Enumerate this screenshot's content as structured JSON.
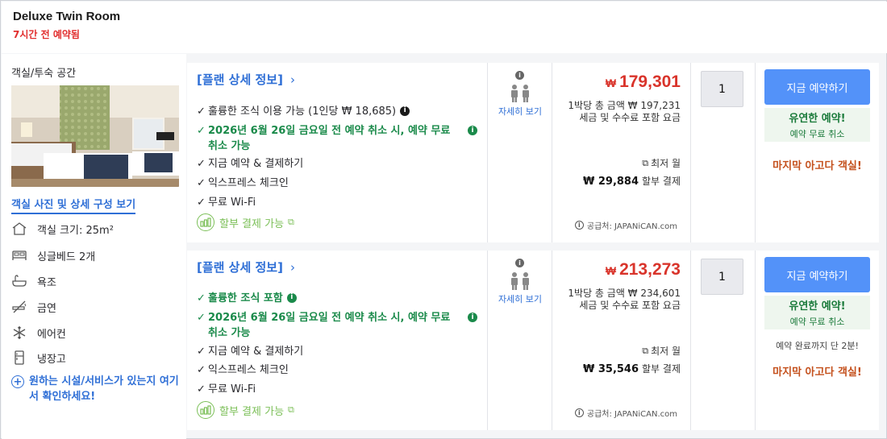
{
  "header": {
    "title": "Deluxe Twin Room",
    "booked_text": "7시간 전 예약됨"
  },
  "room": {
    "section_title": "객실/투숙 공간",
    "photo_link": "객실 사진 및 상세 구성 보기",
    "amenities": [
      {
        "icon": "house-icon",
        "label": "객실 크기: 25m²"
      },
      {
        "icon": "bed-icon",
        "label": "싱글베드 2개"
      },
      {
        "icon": "bathtub-icon",
        "label": "욕조"
      },
      {
        "icon": "no-smoking-icon",
        "label": "금연"
      },
      {
        "icon": "snowflake-icon",
        "label": "에어컨"
      },
      {
        "icon": "fridge-icon",
        "label": "냉장고"
      }
    ],
    "facility_link": "원하는 시설/서비스가 있는지 여기서 확인하세요!"
  },
  "plans": [
    {
      "plan_link": "[플랜 상세 정보]",
      "features": [
        {
          "text": "훌륭한 조식 이용 가능 (1인당 ₩ 18,685)",
          "green": false,
          "info": true
        },
        {
          "text": "2026년 6월 26일 금요일 전 예약 취소 시, 예약 무료 취소 가능",
          "green": true,
          "info": true
        },
        {
          "text": "지금 예약 & 결제하기",
          "green": false,
          "info": false
        },
        {
          "text": "익스프레스 체크인",
          "green": false,
          "info": false
        },
        {
          "text": "무료 Wi-Fi",
          "green": false,
          "info": false
        }
      ],
      "installment": "할부 결제 가능",
      "guests_link": "자세히 보기",
      "currency": "₩",
      "price": "179,301",
      "total_line": "1박당 총 금액 ₩ 197,231",
      "tax_line": "세금 및 수수료 포함 요금",
      "min_month": "최저 월",
      "install_amount": "₩ 29,884",
      "install_label": "할부 결제",
      "supplier": "공급처: JAPANiCAN.com",
      "qty": "1",
      "book_label": "지금 예약하기",
      "flex_title": "유연한 예약!",
      "flex_sub": "예약 무료 취소",
      "countdown": "",
      "last_room": "마지막 아고다 객실!"
    },
    {
      "plan_link": "[플랜 상세 정보]",
      "features": [
        {
          "text": "훌륭한 조식 포함",
          "green": true,
          "info": true,
          "inline": true
        },
        {
          "text": "2026년 6월 26일 금요일 전 예약 취소 시, 예약 무료 취소 가능",
          "green": true,
          "info": true
        },
        {
          "text": "지금 예약 & 결제하기",
          "green": false,
          "info": false
        },
        {
          "text": "익스프레스 체크인",
          "green": false,
          "info": false
        },
        {
          "text": "무료 Wi-Fi",
          "green": false,
          "info": false
        }
      ],
      "installment": "할부 결제 가능",
      "guests_link": "자세히 보기",
      "currency": "₩",
      "price": "213,273",
      "total_line": "1박당 총 금액 ₩ 234,601",
      "tax_line": "세금 및 수수료 포함 요금",
      "min_month": "최저 월",
      "install_amount": "₩ 35,546",
      "install_label": "할부 결제",
      "supplier": "공급처: JAPANiCAN.com",
      "qty": "1",
      "book_label": "지금 예약하기",
      "flex_title": "유연한 예약!",
      "flex_sub": "예약 무료 취소",
      "countdown": "예약 완료까지 단 2분!",
      "last_room": "마지막 아고다 객실!"
    }
  ]
}
